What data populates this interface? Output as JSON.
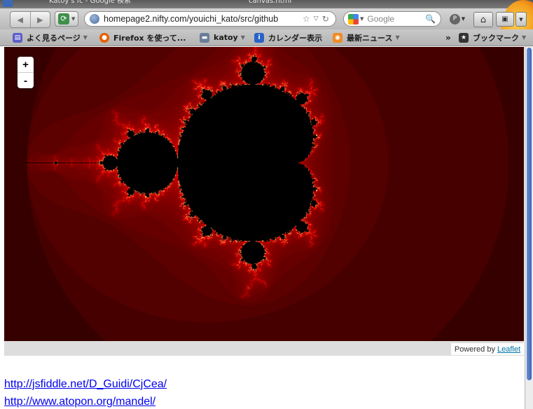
{
  "browser": {
    "tabs": [
      {
        "title": "Katoy's fc - Google 検索"
      },
      {
        "title": "canvas.html"
      }
    ],
    "url": "homepage2.nifty.com/youichi_kato/src/github",
    "search_placeholder": "Google",
    "bookmarks": [
      {
        "label": "よく見るページ",
        "icon": "smart-folder-icon",
        "color": "#5b5fc7"
      },
      {
        "label": "Firefox を使って...",
        "icon": "firefox-icon",
        "color": "#e66000"
      },
      {
        "label": "katoy",
        "icon": "folder-icon",
        "color": "#6a7d99"
      },
      {
        "label": "カレンダー表示",
        "icon": "info-icon",
        "color": "#2a63c8"
      },
      {
        "label": "最新ニュース",
        "icon": "rss-icon",
        "color": "#f08a24"
      },
      {
        "label": "ブックマーク",
        "icon": "bookmarks-icon",
        "color": "#333333"
      }
    ],
    "overflow_label": "»"
  },
  "map": {
    "zoom_in": "+",
    "zoom_out": "-",
    "attribution_prefix": "Powered by",
    "attribution_link": "Leaflet",
    "colors": {
      "inner": "#000000",
      "edge": "#ff2a10",
      "glow": "#b00000",
      "outer": "#1a0000"
    }
  },
  "links": [
    {
      "text": "http://jsfiddle.net/D_Guidi/CjCea/"
    },
    {
      "text": "http://www.atopon.org/mandel/"
    }
  ]
}
